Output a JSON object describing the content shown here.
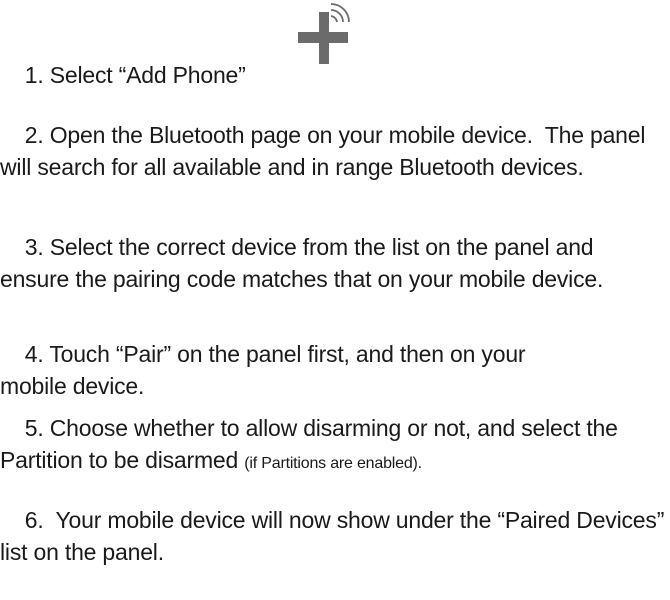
{
  "steps": [
    {
      "text": "1. Select “Add Phone”"
    },
    {
      "text": "2. Open the Bluetooth page on your mobile device.  The panel will search for all available and in range Bluetooth devices."
    },
    {
      "text": "3. Select the correct device from the list on the panel and ensure the pairing code matches that on your mobile device."
    },
    {
      "text": "4. Touch “Pair” on the panel first, and then on your mobile device."
    },
    {
      "text": "5. Choose whether to allow disarming or not, and select the Partition to be disarmed ",
      "note": "(if Partitions are enabled)."
    },
    {
      "text": "6.  Your mobile device will now show under the “Paired Devices” list on the panel."
    }
  ],
  "icon": {
    "name": "add-phone-icon",
    "color": "#6b6b6b"
  }
}
